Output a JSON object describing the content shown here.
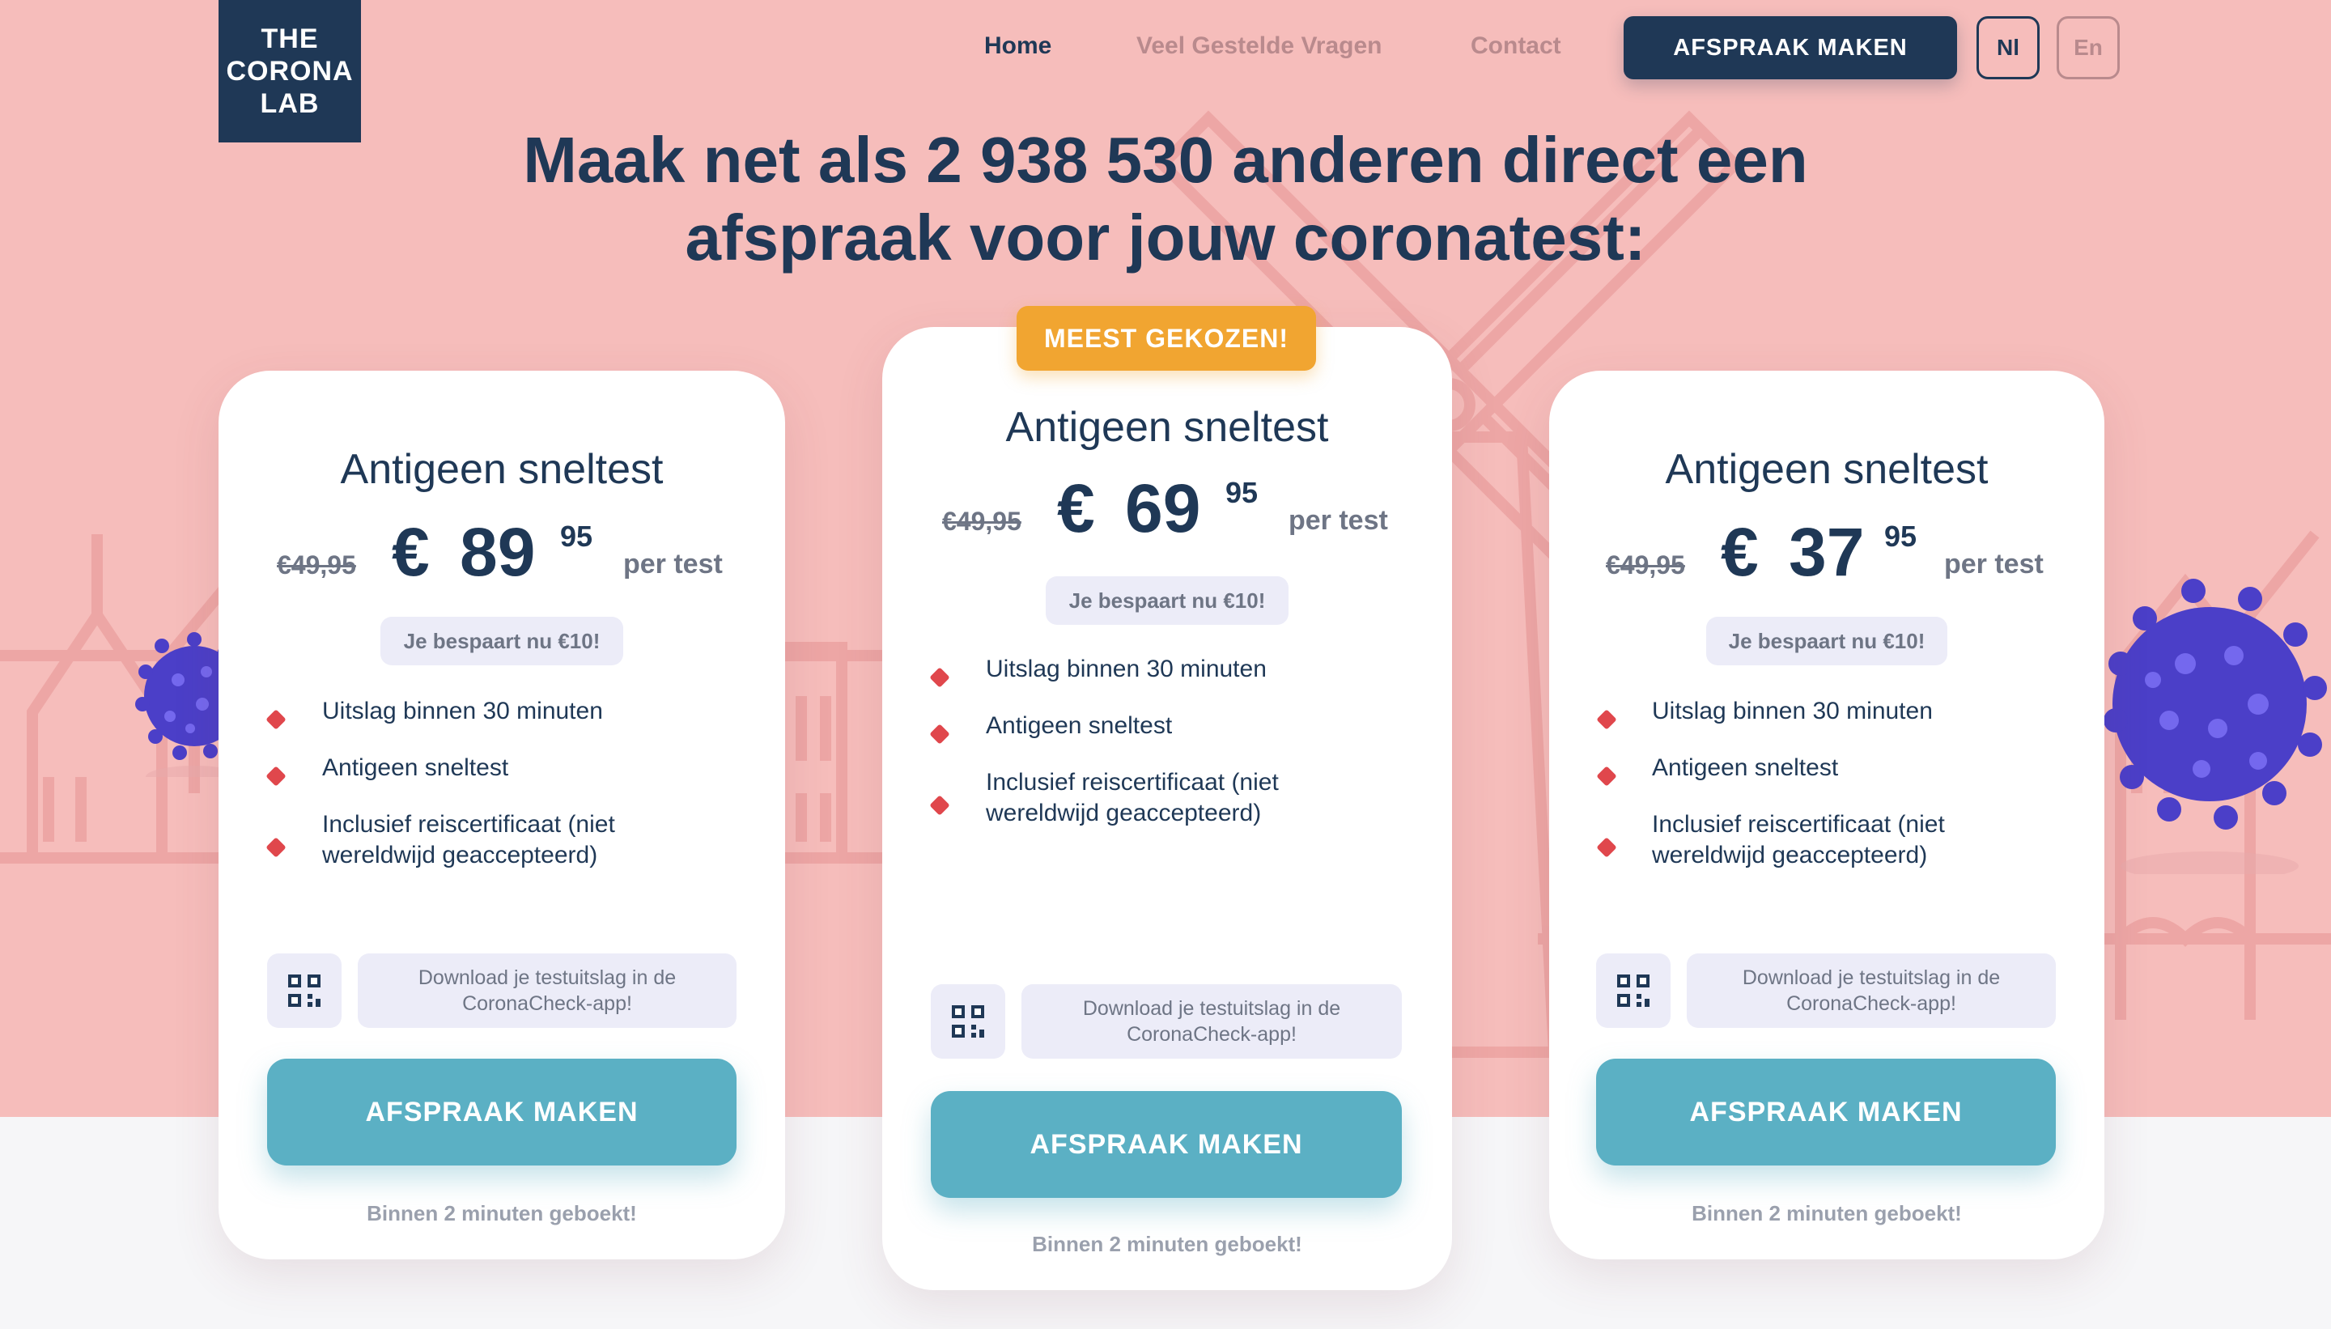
{
  "logo": {
    "line1": "THE",
    "line2": "CORONA",
    "line3": "LAB"
  },
  "nav": {
    "home": "Home",
    "faq": "Veel Gestelde Vragen",
    "contact": "Contact",
    "cta": "AFSPRAAK MAKEN",
    "lang_nl": "Nl",
    "lang_en": "En"
  },
  "headline": {
    "line1": "Maak net als 2 938 530 anderen direct een",
    "line2": "afspraak voor jouw coronatest:"
  },
  "badge": "MEEST GEKOZEN!",
  "cards": [
    {
      "title": "Antigeen sneltest",
      "old_price": "€49,95",
      "euro": "€",
      "price": "89",
      "cents": "95",
      "per": "per test",
      "save": "Je bespaart nu €10!",
      "features": [
        "Uitslag binnen 30 minuten",
        "Antigeen sneltest",
        "Inclusief reiscertificaat (niet",
        "wereldwijd geaccepteerd)"
      ],
      "download_line1": "Download je testuitslag in de",
      "download_line2": "CoronaCheck-app!",
      "cta": "AFSPRAAK MAKEN",
      "booked": "Binnen 2 minuten geboekt!"
    },
    {
      "title": "Antigeen sneltest",
      "old_price": "€49,95",
      "euro": "€",
      "price": "69",
      "cents": "95",
      "per": "per test",
      "save": "Je bespaart nu €10!",
      "features": [
        "Uitslag binnen 30 minuten",
        "Antigeen sneltest",
        "Inclusief reiscertificaat (niet",
        "wereldwijd geaccepteerd)"
      ],
      "download_line1": "Download je testuitslag in de",
      "download_line2": "CoronaCheck-app!",
      "cta": "AFSPRAAK MAKEN",
      "booked": "Binnen 2 minuten geboekt!"
    },
    {
      "title": "Antigeen sneltest",
      "old_price": "€49,95",
      "euro": "€",
      "price": "37",
      "cents": "95",
      "per": "per test",
      "save": "Je bespaart nu €10!",
      "features": [
        "Uitslag binnen 30 minuten",
        "Antigeen sneltest",
        "Inclusief reiscertificaat (niet",
        "wereldwijd geaccepteerd)"
      ],
      "download_line1": "Download je testuitslag in de",
      "download_line2": "CoronaCheck-app!",
      "cta": "AFSPRAAK MAKEN",
      "booked": "Binnen 2 minuten geboekt!"
    }
  ],
  "colors": {
    "hero_bg": "#f6bdbb",
    "navy": "#1f3856",
    "accent_orange": "#f1a531",
    "cta_teal": "#5bb0c4",
    "bullet_red": "#e0474c",
    "virus_purple": "#5a4fd6"
  }
}
